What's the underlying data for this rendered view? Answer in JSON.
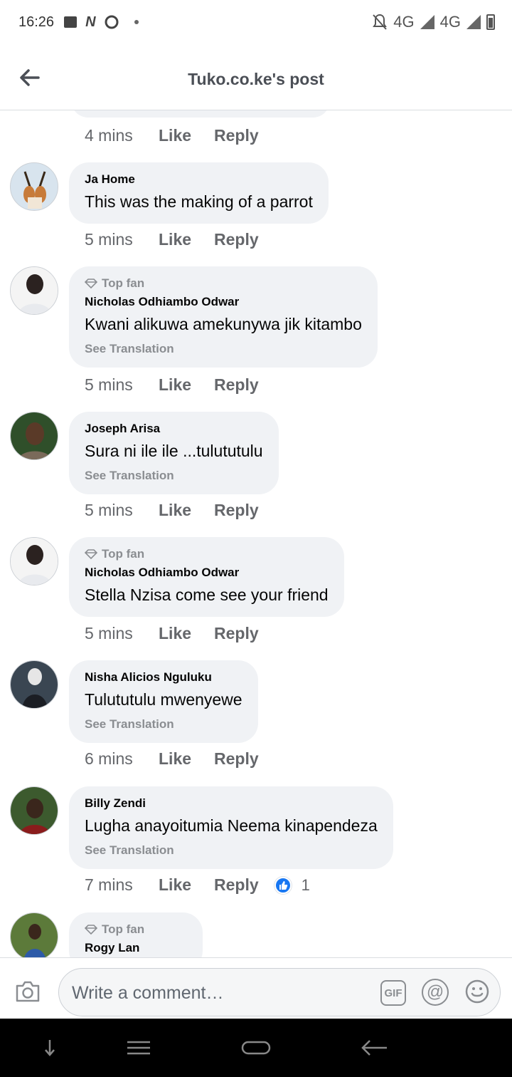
{
  "status_bar": {
    "time": "16:26",
    "network_1": "4G",
    "network_2": "4G",
    "network_small": "4G"
  },
  "header": {
    "title": "Tuko.co.ke's post"
  },
  "top_partial": {
    "time": "4 mins",
    "like": "Like",
    "reply": "Reply"
  },
  "comments": [
    {
      "author": "Ja Home",
      "text": "This was the making of a parrot",
      "top_fan": "",
      "translation": "",
      "time": "5 mins",
      "like": "Like",
      "reply": "Reply"
    },
    {
      "author": "Nicholas Odhiambo Odwar",
      "text": "Kwani alikuwa amekunywa jik kitambo",
      "top_fan": "Top fan",
      "translation": "See Translation",
      "time": "5 mins",
      "like": "Like",
      "reply": "Reply"
    },
    {
      "author": "Joseph Arisa",
      "text": "Sura ni ile ile ...tulututulu",
      "top_fan": "",
      "translation": "See Translation",
      "time": "5 mins",
      "like": "Like",
      "reply": "Reply"
    },
    {
      "author": "Nicholas Odhiambo Odwar",
      "text": "Stella Nzisa come see your friend",
      "top_fan": "Top fan",
      "translation": "",
      "time": "5 mins",
      "like": "Like",
      "reply": "Reply"
    },
    {
      "author": "Nisha Alicios Nguluku",
      "text": "Tulututulu mwenyewe",
      "top_fan": "",
      "translation": "See Translation",
      "time": "6 mins",
      "like": "Like",
      "reply": "Reply"
    },
    {
      "author": "Billy Zendi",
      "text": "Lugha anayoitumia Neema kinapendeza",
      "top_fan": "",
      "translation": "See Translation",
      "time": "7 mins",
      "like": "Like",
      "reply": "Reply",
      "reaction_count": "1"
    },
    {
      "author": "Rogy Lan",
      "text": "",
      "top_fan": "Top fan",
      "translation": "",
      "time": "",
      "like": "",
      "reply": ""
    }
  ],
  "composer": {
    "placeholder": "Write a comment…",
    "gif_label": "GIF",
    "at_label": "@"
  },
  "colors": {
    "bubble": "#f0f2f5",
    "meta_text": "#65676b",
    "like_blue": "#1877f2",
    "nav_bg": "#000000"
  },
  "icons": {
    "back": "arrow-left-icon",
    "camera": "camera-icon",
    "emoji": "smile-icon",
    "diamond": "diamond-icon",
    "like_reaction": "thumbs-up-icon"
  }
}
